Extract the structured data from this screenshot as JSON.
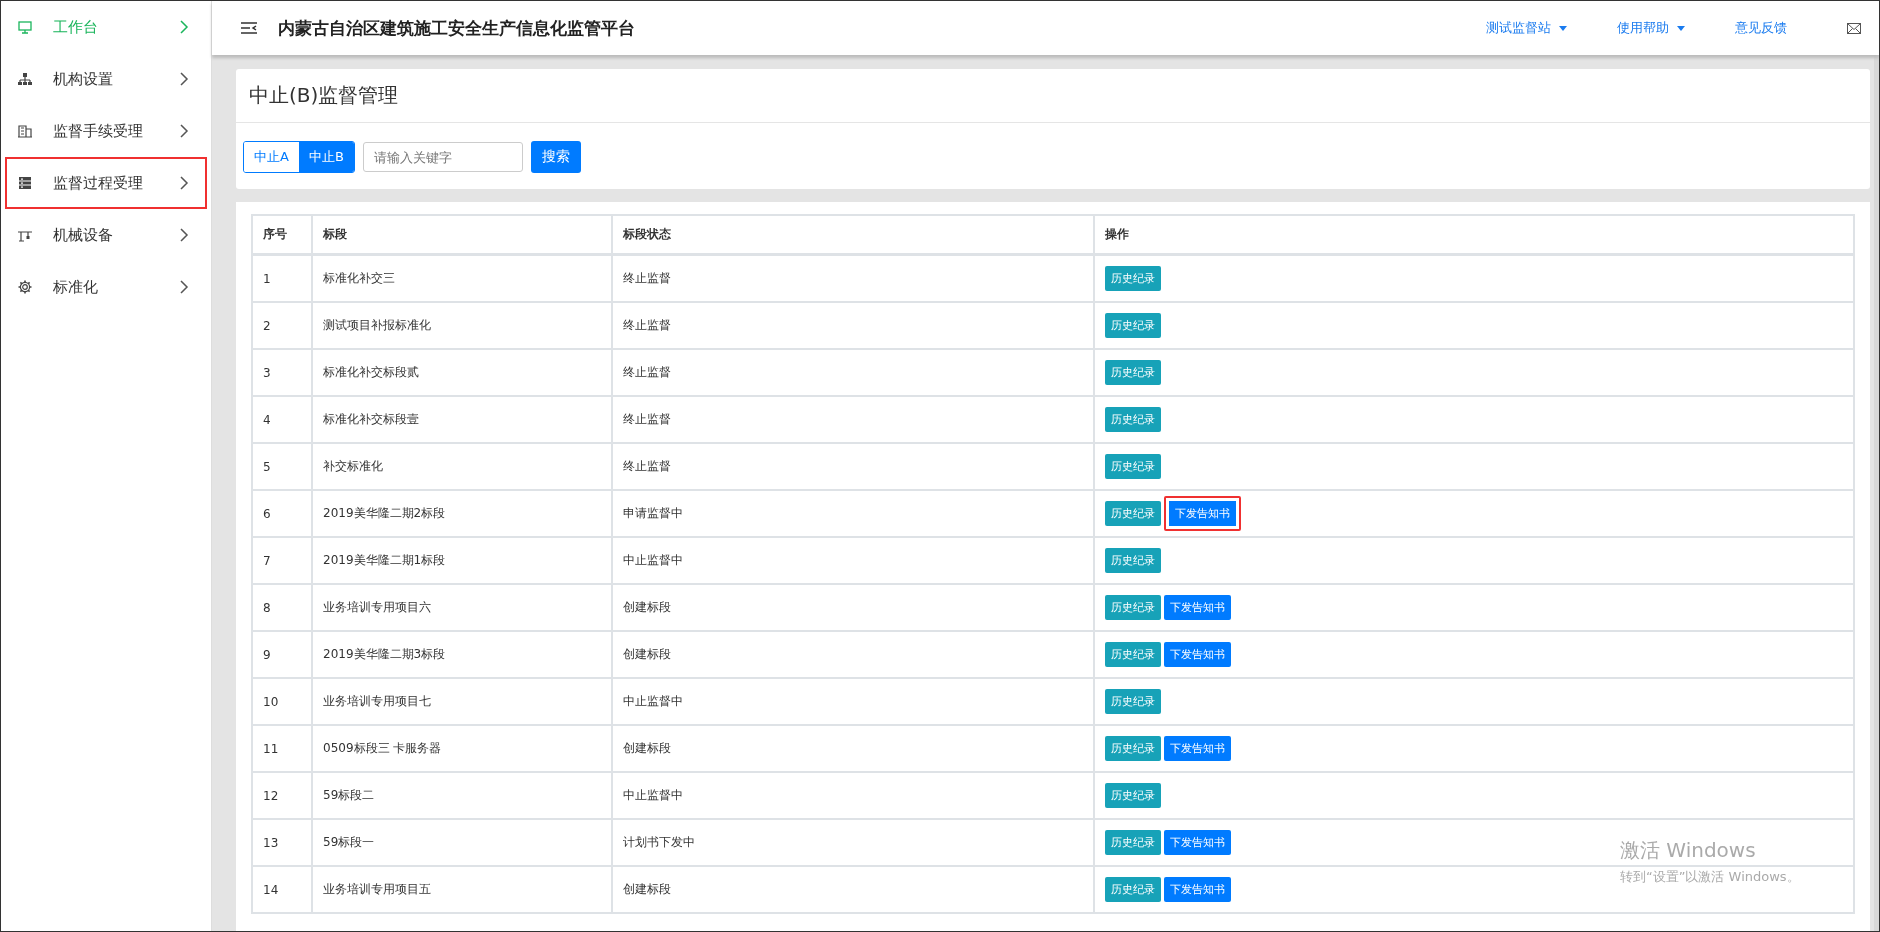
{
  "sidebar": {
    "items": [
      {
        "label": "工作台",
        "selected": true,
        "highlighted": false
      },
      {
        "label": "机构设置",
        "selected": false,
        "highlighted": false
      },
      {
        "label": "监督手续受理",
        "selected": false,
        "highlighted": false
      },
      {
        "label": "监督过程受理",
        "selected": false,
        "highlighted": true
      },
      {
        "label": "机械设备",
        "selected": false,
        "highlighted": false
      },
      {
        "label": "标准化",
        "selected": false,
        "highlighted": false
      }
    ]
  },
  "header": {
    "title": "内蒙古自治区建筑施工安全生产信息化监管平台",
    "menus": [
      {
        "label": "测试监督站",
        "kind": "dropdown"
      },
      {
        "label": "使用帮助",
        "kind": "dropdown"
      },
      {
        "label": "意见反馈",
        "kind": "link"
      }
    ]
  },
  "page": {
    "title": "中止(B)监督管理",
    "toggles": [
      {
        "label": "中止A",
        "selected": false
      },
      {
        "label": "中止B",
        "selected": true
      }
    ],
    "search": {
      "placeholder": "请输入关键字",
      "button": "搜索"
    }
  },
  "table": {
    "columns": [
      "序号",
      "标段",
      "标段状态",
      "操作"
    ],
    "rows": [
      {
        "cells": [
          "1",
          "标准化补交三",
          "终止监督"
        ],
        "actions": [
          {
            "label": "历史纪录",
            "kind": "history",
            "highlighted": false
          }
        ]
      },
      {
        "cells": [
          "2",
          "测试项目补报标准化",
          "终止监督"
        ],
        "actions": [
          {
            "label": "历史纪录",
            "kind": "history",
            "highlighted": false
          }
        ]
      },
      {
        "cells": [
          "3",
          "标准化补交标段贰",
          "终止监督"
        ],
        "actions": [
          {
            "label": "历史纪录",
            "kind": "history",
            "highlighted": false
          }
        ]
      },
      {
        "cells": [
          "4",
          "标准化补交标段壹",
          "终止监督"
        ],
        "actions": [
          {
            "label": "历史纪录",
            "kind": "history",
            "highlighted": false
          }
        ]
      },
      {
        "cells": [
          "5",
          "补交标准化",
          "终止监督"
        ],
        "actions": [
          {
            "label": "历史纪录",
            "kind": "history",
            "highlighted": false
          }
        ]
      },
      {
        "cells": [
          "6",
          "2019美华隆二期2标段",
          "申请监督中"
        ],
        "actions": [
          {
            "label": "历史纪录",
            "kind": "history",
            "highlighted": false
          },
          {
            "label": "下发告知书",
            "kind": "notice",
            "highlighted": true
          }
        ]
      },
      {
        "cells": [
          "7",
          "2019美华隆二期1标段",
          "中止监督中"
        ],
        "actions": [
          {
            "label": "历史纪录",
            "kind": "history",
            "highlighted": false
          }
        ]
      },
      {
        "cells": [
          "8",
          "业务培训专用项目六",
          "创建标段"
        ],
        "actions": [
          {
            "label": "历史纪录",
            "kind": "history",
            "highlighted": false
          },
          {
            "label": "下发告知书",
            "kind": "notice",
            "highlighted": false
          }
        ]
      },
      {
        "cells": [
          "9",
          "2019美华隆二期3标段",
          "创建标段"
        ],
        "actions": [
          {
            "label": "历史纪录",
            "kind": "history",
            "highlighted": false
          },
          {
            "label": "下发告知书",
            "kind": "notice",
            "highlighted": false
          }
        ]
      },
      {
        "cells": [
          "10",
          "业务培训专用项目七",
          "中止监督中"
        ],
        "actions": [
          {
            "label": "历史纪录",
            "kind": "history",
            "highlighted": false
          }
        ]
      },
      {
        "cells": [
          "11",
          "0509标段三 卡服务器",
          "创建标段"
        ],
        "actions": [
          {
            "label": "历史纪录",
            "kind": "history",
            "highlighted": false
          },
          {
            "label": "下发告知书",
            "kind": "notice",
            "highlighted": false
          }
        ]
      },
      {
        "cells": [
          "12",
          "59标段二",
          "中止监督中"
        ],
        "actions": [
          {
            "label": "历史纪录",
            "kind": "history",
            "highlighted": false
          }
        ]
      },
      {
        "cells": [
          "13",
          "59标段一",
          "计划书下发中"
        ],
        "actions": [
          {
            "label": "历史纪录",
            "kind": "history",
            "highlighted": false
          },
          {
            "label": "下发告知书",
            "kind": "notice",
            "highlighted": false
          }
        ]
      },
      {
        "cells": [
          "14",
          "业务培训专用项目五",
          "创建标段"
        ],
        "actions": [
          {
            "label": "历史纪录",
            "kind": "history",
            "highlighted": false
          },
          {
            "label": "下发告知书",
            "kind": "notice",
            "highlighted": false
          }
        ]
      }
    ]
  },
  "os_overlay": {
    "title": "激活 Windows",
    "subtitle": "转到“设置”以激活 Windows。"
  }
}
